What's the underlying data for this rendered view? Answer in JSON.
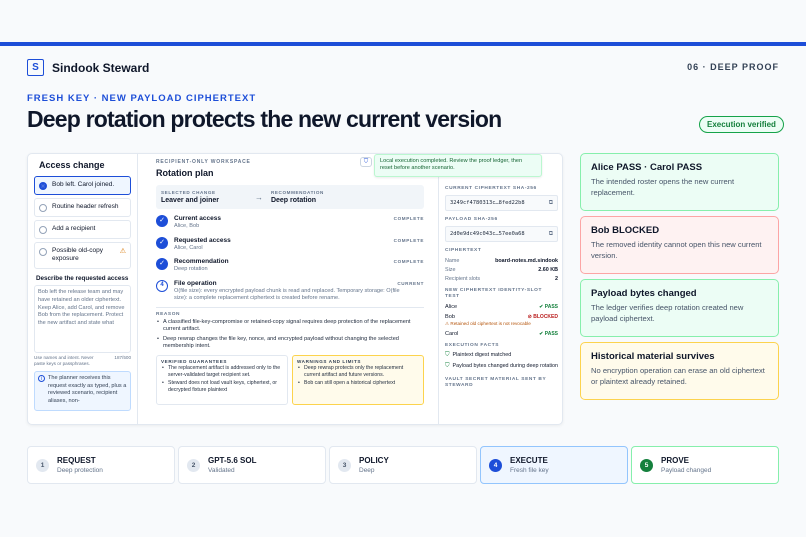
{
  "brand": {
    "logo_letter": "S",
    "name": "Sindook Steward"
  },
  "slide_number": "06 · DEEP PROOF",
  "kicker": "FRESH KEY · NEW PAYLOAD CIPHERTEXT",
  "headline": "Deep rotation protects the new current version",
  "verified_badge": "Execution verified",
  "app": {
    "left": {
      "title": "Access change",
      "options": [
        {
          "label": "Bob left. Carol joined.",
          "selected": true
        },
        {
          "label": "Routine header refresh",
          "selected": false
        },
        {
          "label": "Add a recipient",
          "selected": false
        },
        {
          "label": "Possible old-copy exposure",
          "selected": false,
          "warn": "⚠"
        }
      ],
      "describe_label": "Describe the requested access",
      "describe_text": "Bob left the release team and may have retained an older ciphertext. Keep Alice, add Carol, and remove Bob from the replacement. Protect the new artifact and state what",
      "hint_left": "Use names and intent. Never paste keys or passphrases.",
      "hint_right": "187/500",
      "info_text": "The planner receives this request exactly as typed, plus a reviewed scenario, recipient aliases, non-"
    },
    "center": {
      "workspace": "RECIPIENT-ONLY WORKSPACE",
      "title": "Rotation plan",
      "toast": "Local execution completed. Review the proof ledger, then reset before another scenario.",
      "selected_change_label": "SELECTED CHANGE",
      "selected_change": "Leaver and joiner",
      "recommendation_label": "RECOMMENDATION",
      "recommendation": "Deep rotation",
      "steps": [
        {
          "title": "Current access",
          "sub": "Alice, Bob",
          "tag": "COMPLETE",
          "mark": "✓"
        },
        {
          "title": "Requested access",
          "sub": "Alice, Carol",
          "tag": "COMPLETE",
          "mark": "✓"
        },
        {
          "title": "Recommendation",
          "sub": "Deep rotation",
          "tag": "COMPLETE",
          "mark": "✓"
        },
        {
          "title": "File operation",
          "sub": "O(file size): every encrypted payload chunk is read and replaced. Temporary storage: O(file size): a complete replacement ciphertext is created before rename.",
          "tag": "CURRENT",
          "mark": "4"
        }
      ],
      "reason_label": "REASON",
      "reasons": [
        "A classified file-key-compromise or retained-copy signal requires deep protection of the replacement current artifact.",
        "Deep rewrap changes the file key, nonce, and encrypted payload without changing the selected membership intent."
      ],
      "guarantees_label": "VERIFIED GUARANTEES",
      "guarantees": [
        "The replacement artifact is addressed only to the server-validated target recipient set.",
        "Steward does not load vault keys, ciphertext, or decrypted fixture plaintext"
      ],
      "warnings_label": "WARNINGS AND LIMITS",
      "warnings": [
        "Deep rewrap protects only the replacement current artifact and future versions.",
        "Bob can still open a historical ciphertext"
      ]
    },
    "right": {
      "cur_hash_label": "CURRENT CIPHERTEXT SHA-256",
      "cur_hash": "3249cf4780313c…8fed22b8",
      "payload_hash_label": "PAYLOAD SHA-256",
      "payload_hash": "2d0e9dc49c043c…57ee0a68",
      "ciphertext_label": "CIPHERTEXT",
      "facts_kv": [
        {
          "k": "Name",
          "v": "board-notes.md.sindook"
        },
        {
          "k": "Size",
          "v": "2.60 KB"
        },
        {
          "k": "Recipient slots",
          "v": "2"
        }
      ],
      "slot_label": "NEW CIPHERTEXT IDENTITY-SLOT TEST",
      "slots": [
        {
          "name": "Alice",
          "status": "PASS",
          "type": "pass"
        },
        {
          "name": "Bob",
          "status": "BLOCKED",
          "type": "blocked"
        },
        {
          "name": "Carol",
          "status": "PASS",
          "type": "pass"
        }
      ],
      "bob_note": "Retained old ciphertext is not revocable",
      "exec_label": "EXECUTION FACTS",
      "exec_facts": [
        "Plaintext digest matched",
        "Payload bytes changed during deep rotation"
      ],
      "vault_label": "VAULT SECRET MATERIAL SENT BY STEWARD"
    }
  },
  "outcomes": [
    {
      "title": "Alice PASS · Carol PASS",
      "desc": "The intended roster opens the new current replacement.",
      "tone": "green"
    },
    {
      "title": "Bob BLOCKED",
      "desc": "The removed identity cannot open this new current version.",
      "tone": "red"
    },
    {
      "title": "Payload bytes changed",
      "desc": "The ledger verifies deep rotation created new payload ciphertext.",
      "tone": "green"
    },
    {
      "title": "Historical material survives",
      "desc": "No encryption operation can erase an old ciphertext or plaintext already retained.",
      "tone": "amber"
    }
  ],
  "pipeline": [
    {
      "num": "1",
      "title": "REQUEST",
      "desc": "Deep protection",
      "state": "plain"
    },
    {
      "num": "2",
      "title": "GPT-5.6 SOL",
      "desc": "Validated",
      "state": "plain"
    },
    {
      "num": "3",
      "title": "POLICY",
      "desc": "Deep",
      "state": "plain"
    },
    {
      "num": "4",
      "title": "EXECUTE",
      "desc": "Fresh file key",
      "state": "active"
    },
    {
      "num": "5",
      "title": "PROVE",
      "desc": "Payload changed",
      "state": "done"
    }
  ]
}
